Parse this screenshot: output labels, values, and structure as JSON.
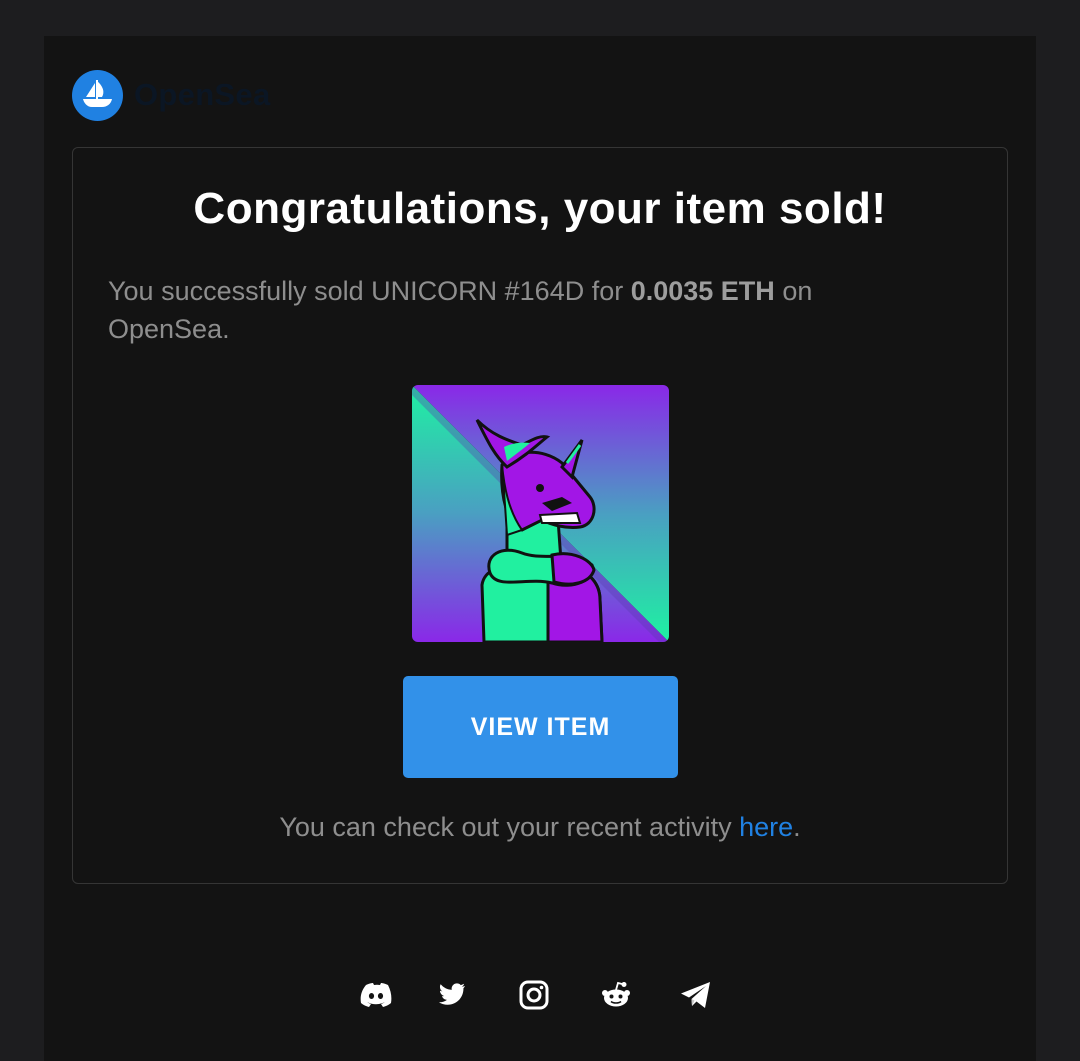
{
  "brand": {
    "name": "OpenSea",
    "logo_icon": "opensea-ship-icon",
    "accent": "#2081e2"
  },
  "card": {
    "title": "Congratulations, your item sold!",
    "message_prefix": "You successfully sold UNICORN #164D for ",
    "price": "0.0035 ETH",
    "message_suffix": " on OpenSea.",
    "item_image": "unicorn-nft-artwork",
    "button_label": "VIEW ITEM",
    "button_color": "#3291e9",
    "activity_prefix": "You can check out your recent activity ",
    "activity_link": "here",
    "activity_suffix": "."
  },
  "social": [
    {
      "icon": "discord-icon"
    },
    {
      "icon": "twitter-icon"
    },
    {
      "icon": "instagram-icon"
    },
    {
      "icon": "reddit-icon"
    },
    {
      "icon": "telegram-icon"
    }
  ]
}
